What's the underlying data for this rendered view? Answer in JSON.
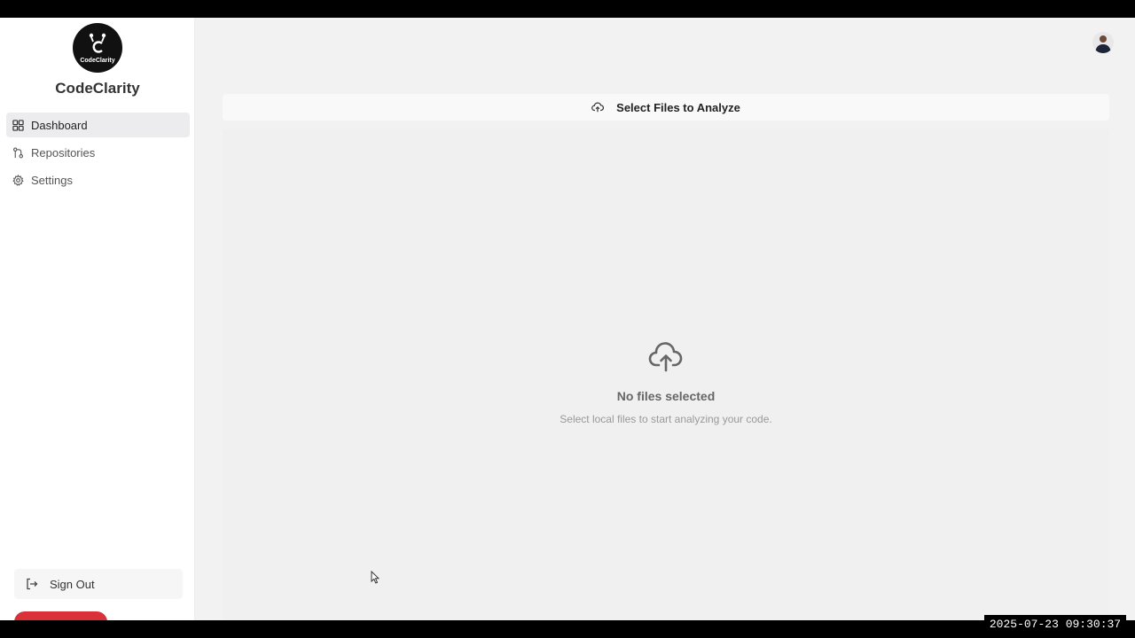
{
  "app": {
    "name": "CodeClarity",
    "logo_text": "CodeClarity"
  },
  "sidebar": {
    "items": [
      {
        "label": "Dashboard",
        "icon": "dashboard-grid-icon",
        "active": true
      },
      {
        "label": "Repositories",
        "icon": "git-branch-icon",
        "active": false
      },
      {
        "label": "Settings",
        "icon": "gear-icon",
        "active": false
      }
    ],
    "sign_out_label": "Sign Out"
  },
  "main": {
    "upload_button_label": "Select Files to Analyze",
    "empty_state": {
      "title": "No files selected",
      "subtitle": "Select local files to start analyzing your code."
    }
  },
  "overlay": {
    "timestamp": "2025-07-23 09:30:37"
  },
  "colors": {
    "sidebar_bg": "#ffffff",
    "main_bg": "#f2f2f3",
    "accent_red": "#d9303a",
    "active_item_bg": "#ececef"
  }
}
